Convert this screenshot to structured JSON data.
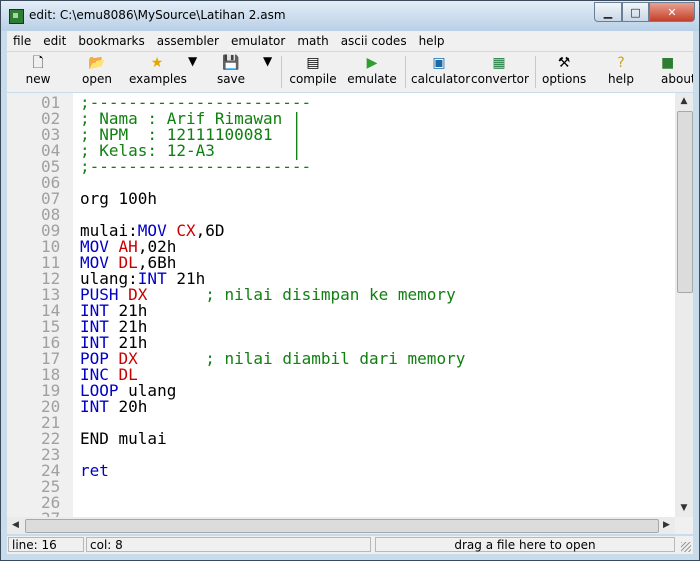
{
  "window": {
    "title": "edit: C:\\emu8086\\MySource\\Latihan 2.asm"
  },
  "menu": [
    "file",
    "edit",
    "bookmarks",
    "assembler",
    "emulator",
    "math",
    "ascii codes",
    "help"
  ],
  "toolbar": {
    "new": "new",
    "open": "open",
    "examples": "examples",
    "save": "save",
    "compile": "compile",
    "emulate": "emulate",
    "calculator": "calculator",
    "convertor": "convertor",
    "options": "options",
    "help": "help",
    "about": "about"
  },
  "editor": {
    "lines": [
      {
        "n": "01",
        "t": [
          [
            "cm",
            ";-----------------------"
          ]
        ]
      },
      {
        "n": "02",
        "t": [
          [
            "cm",
            "; Nama : Arif Rimawan |"
          ]
        ]
      },
      {
        "n": "03",
        "t": [
          [
            "cm",
            "; NPM  : 12111100081  |"
          ]
        ]
      },
      {
        "n": "04",
        "t": [
          [
            "cm",
            "; Kelas: 12-A3        |"
          ]
        ]
      },
      {
        "n": "05",
        "t": [
          [
            "cm",
            ";-----------------------"
          ]
        ]
      },
      {
        "n": "06",
        "t": []
      },
      {
        "n": "07",
        "t": [
          [
            "",
            "org 100h"
          ]
        ]
      },
      {
        "n": "08",
        "t": []
      },
      {
        "n": "09",
        "t": [
          [
            "",
            "mulai:"
          ],
          [
            "kw",
            "MOV"
          ],
          [
            "",
            " "
          ],
          [
            "reg",
            "CX"
          ],
          [
            "",
            ",6D"
          ]
        ]
      },
      {
        "n": "10",
        "t": [
          [
            "kw",
            "MOV"
          ],
          [
            "",
            " "
          ],
          [
            "reg",
            "AH"
          ],
          [
            "",
            ",02h"
          ]
        ]
      },
      {
        "n": "11",
        "t": [
          [
            "kw",
            "MOV"
          ],
          [
            "",
            " "
          ],
          [
            "reg",
            "DL"
          ],
          [
            "",
            ",6Bh"
          ]
        ]
      },
      {
        "n": "12",
        "t": [
          [
            "",
            "ulang:"
          ],
          [
            "kw",
            "INT"
          ],
          [
            "",
            " 21h"
          ]
        ]
      },
      {
        "n": "13",
        "t": [
          [
            "kw",
            "PUSH"
          ],
          [
            "",
            " "
          ],
          [
            "reg",
            "DX"
          ],
          [
            "",
            " "
          ],
          [
            "cm",
            "     ; nilai disimpan ke memory"
          ]
        ]
      },
      {
        "n": "14",
        "t": [
          [
            "kw",
            "INT"
          ],
          [
            "",
            " 21h"
          ]
        ]
      },
      {
        "n": "15",
        "t": [
          [
            "kw",
            "INT"
          ],
          [
            "",
            " 21h"
          ]
        ]
      },
      {
        "n": "16",
        "t": [
          [
            "kw",
            "INT"
          ],
          [
            "",
            " 21h"
          ]
        ]
      },
      {
        "n": "17",
        "t": [
          [
            "kw",
            "POP"
          ],
          [
            "",
            " "
          ],
          [
            "reg",
            "DX"
          ],
          [
            "",
            " "
          ],
          [
            "cm",
            "      ; nilai diambil dari memory"
          ]
        ]
      },
      {
        "n": "18",
        "t": [
          [
            "kw",
            "INC"
          ],
          [
            "",
            " "
          ],
          [
            "reg",
            "DL"
          ]
        ]
      },
      {
        "n": "19",
        "t": [
          [
            "kw",
            "LOOP"
          ],
          [
            "",
            " ulang"
          ]
        ]
      },
      {
        "n": "20",
        "t": [
          [
            "kw",
            "INT"
          ],
          [
            "",
            " 20h"
          ]
        ]
      },
      {
        "n": "21",
        "t": []
      },
      {
        "n": "22",
        "t": [
          [
            "",
            "END mulai"
          ]
        ]
      },
      {
        "n": "23",
        "t": []
      },
      {
        "n": "24",
        "t": [
          [
            "kw",
            "ret"
          ]
        ]
      },
      {
        "n": "25",
        "t": []
      },
      {
        "n": "26",
        "t": []
      },
      {
        "n": "27",
        "t": []
      }
    ]
  },
  "status": {
    "line": "line: 16",
    "col": "col: 8",
    "hint": "drag a file here to open"
  }
}
